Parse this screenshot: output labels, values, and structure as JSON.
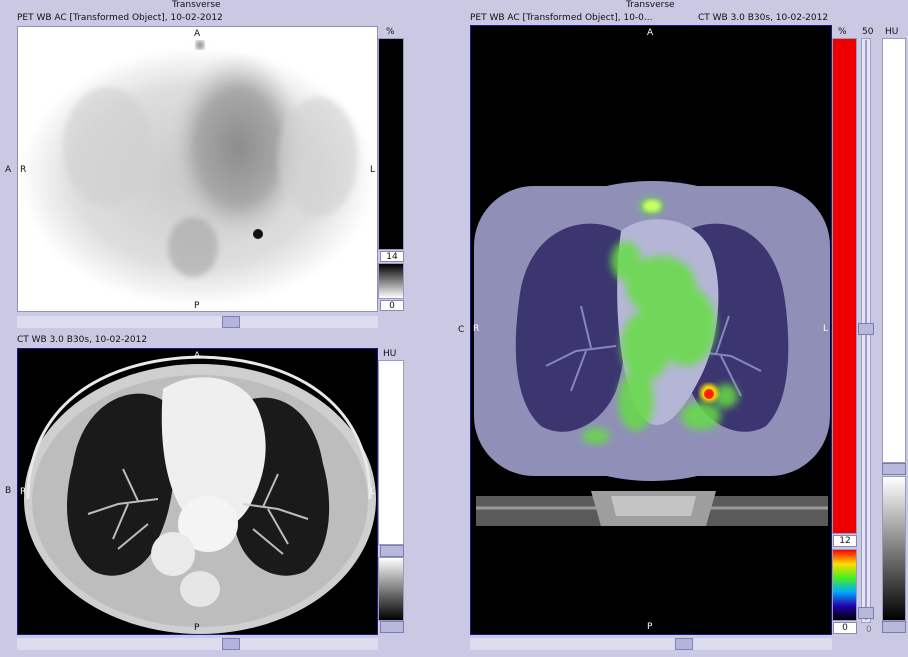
{
  "header": {
    "left_view_title": "Transverse",
    "right_view_title": "Transverse"
  },
  "pet_view": {
    "caption": "PET WB AC [Transformed Object], 10-02-2012",
    "orient_top": "A",
    "orient_left": "R",
    "orient_right": "L",
    "orient_bottom": "P",
    "row_letter": "A",
    "scale_unit": "%",
    "scale_max": "14",
    "scale_min": "0"
  },
  "ct_view": {
    "caption": "CT WB  3.0  B30s, 10-02-2012",
    "orient_top": "A",
    "orient_left": "R",
    "orient_right": "L",
    "orient_bottom": "P",
    "row_letter": "B",
    "scale_unit": "HU"
  },
  "fused_view": {
    "caption_left": "PET WB AC [Transformed Object], 10-0...",
    "caption_right": "CT WB  3.0  B30s, 10-02-2012",
    "orient_top": "A",
    "orient_left": "R",
    "orient_right": "L",
    "orient_bottom": "P",
    "row_letter": "C",
    "pet_scale_unit": "%",
    "blend_value": "50",
    "ct_scale_unit": "HU",
    "pet_scale_max": "12",
    "pet_scale_min": "0",
    "blend_min": "0"
  },
  "colors": {
    "background": "#c9c9e3",
    "viewport_border": "#1a1a8c",
    "hot_iron_red": "#ee0000"
  }
}
